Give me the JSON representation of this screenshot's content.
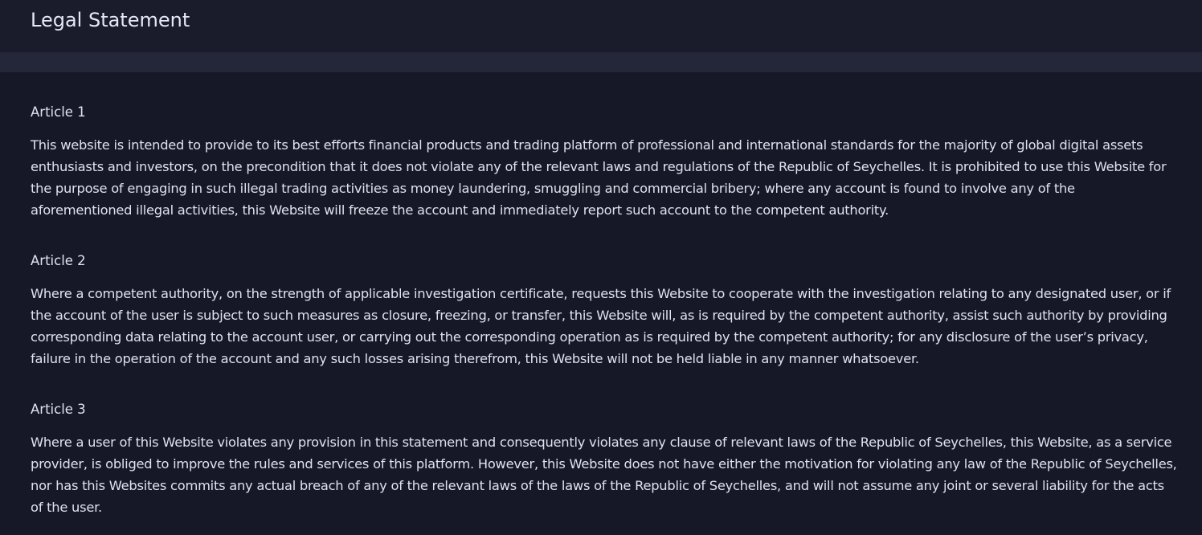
{
  "header": {
    "title": "Legal Statement"
  },
  "articles": [
    {
      "title": "Article 1",
      "body": "This website is intended to provide to its best efforts financial products and trading platform of professional and international standards for the majority of global digital assets enthusiasts and investors, on the precondition that it does not violate any of the relevant laws and regulations of the Republic of Seychelles. It is prohibited to use this Website for the purpose of engaging in such illegal trading activities as money laundering, smuggling and commercial bribery; where any account is found to involve any of the aforementioned illegal activities, this Website will freeze the account and immediately report such account to the competent authority."
    },
    {
      "title": "Article 2",
      "body": "Where a competent authority, on the strength of applicable investigation certificate, requests this Website to cooperate with the investigation relating to any designated user, or if the account of the user is subject to such measures as closure, freezing, or transfer, this Website will, as is required by the competent authority, assist such authority by providing corresponding data relating to the account user, or carrying out the corresponding operation as is required by the competent authority; for any disclosure of the user’s privacy, failure in the operation of the account and any such losses arising therefrom, this Website will not be held liable in any manner whatsoever."
    },
    {
      "title": "Article 3",
      "body": "Where a user of this Website violates any provision in this statement and consequently violates any clause of relevant laws of the Republic of Seychelles, this Website, as a service provider, is obliged to improve the rules and services of this platform. However, this Website does not have either the motivation for violating any law of the Republic of Seychelles, nor has this Websites commits any actual breach of any of the relevant laws of the laws of the Republic of Seychelles, and will not assume any joint or several liability for the acts of the user."
    }
  ],
  "colors": {
    "background": "#161827",
    "header_background": "#1a1c2c",
    "divider_band": "#242639",
    "text": "#dfe1ee"
  }
}
